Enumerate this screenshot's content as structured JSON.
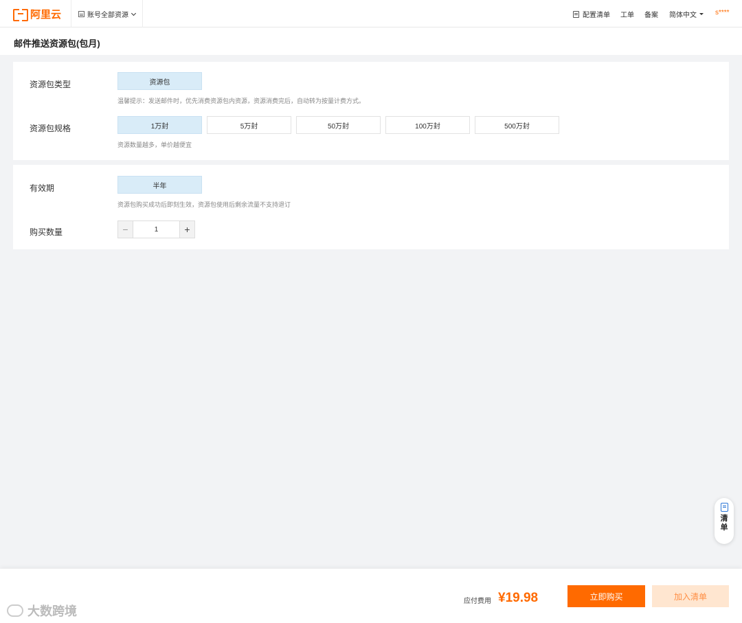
{
  "header": {
    "logo_text": "阿里云",
    "account_menu": "账号全部资源",
    "config_list": "配置清单",
    "ticket": "工单",
    "filing": "备案",
    "language": "简体中文",
    "user": "s****"
  },
  "page": {
    "title": "邮件推送资源包(包月)"
  },
  "section1": {
    "pkg_type_label": "资源包类型",
    "pkg_type_option": "资源包",
    "pkg_type_hint": "温馨提示：发送邮件时，优先消费资源包内资源，资源消费完后，自动转为按量计费方式。",
    "spec_label": "资源包规格",
    "spec_options": [
      "1万封",
      "5万封",
      "50万封",
      "100万封",
      "500万封"
    ],
    "spec_selected": "1万封",
    "spec_hint": "资源数量越多，单价越便宜"
  },
  "section2": {
    "validity_label": "有效期",
    "validity_option": "半年",
    "validity_hint": "资源包购买成功后即刻生效，资源包使用后剩余流量不支持退订",
    "qty_label": "购买数量",
    "qty_value": "1",
    "minus": "−",
    "plus": "+"
  },
  "float_cart": {
    "label": "清单"
  },
  "footer": {
    "fee_label": "应付费用",
    "fee": "¥19.98",
    "buy_now": "立即购买",
    "add_to_list": "加入清单",
    "watermark": "大数跨境"
  }
}
